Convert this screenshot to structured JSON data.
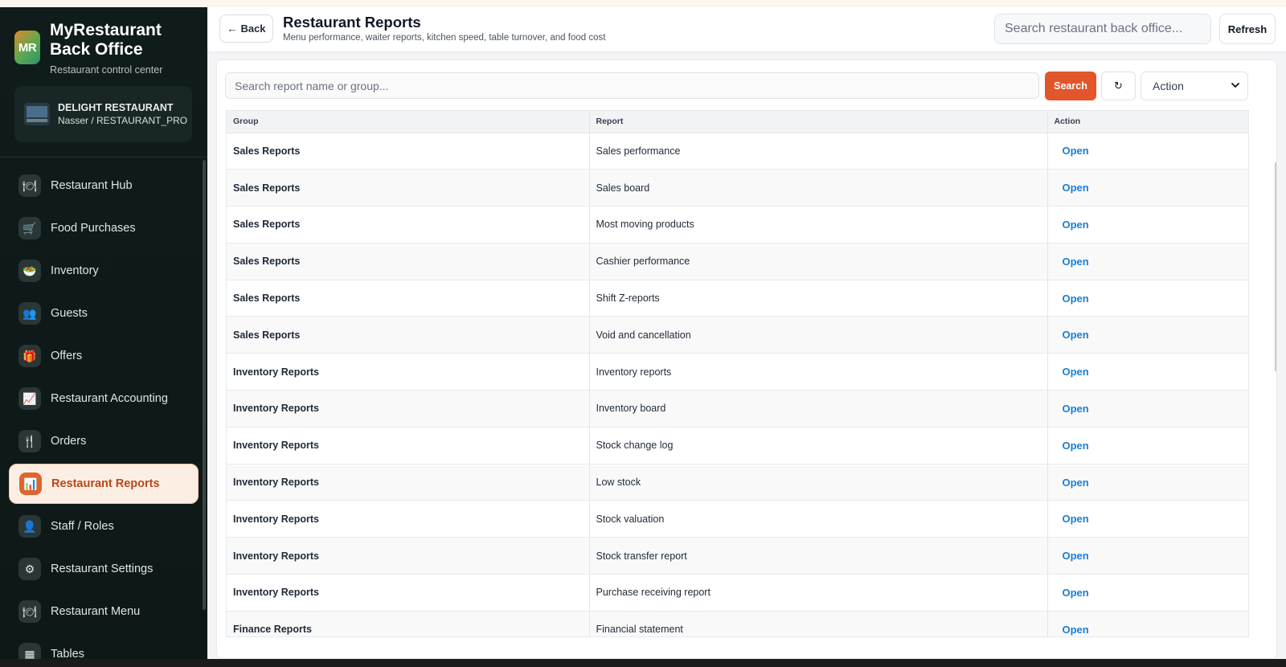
{
  "brand": {
    "logo_text": "MR",
    "title": "MyRestaurant Back Office",
    "subtitle": "Restaurant control center"
  },
  "store": {
    "name": "DELIGHT RESTAURANT",
    "user": "Nasser / RESTAURANT_PRO"
  },
  "sidebar": {
    "items": [
      {
        "label": "Restaurant Hub",
        "icon": "plate-icon",
        "glyph": "🍽"
      },
      {
        "label": "Food Purchases",
        "icon": "cart-icon",
        "glyph": "🛒"
      },
      {
        "label": "Inventory",
        "icon": "bowl-icon",
        "glyph": "🥗"
      },
      {
        "label": "Guests",
        "icon": "people-icon",
        "glyph": "👥"
      },
      {
        "label": "Offers",
        "icon": "gift-icon",
        "glyph": "🎁"
      },
      {
        "label": "Restaurant Accounting",
        "icon": "chart-up-icon",
        "glyph": "📈"
      },
      {
        "label": "Orders",
        "icon": "fork-knife-icon",
        "glyph": "🍴"
      },
      {
        "label": "Restaurant Reports",
        "icon": "bar-chart-icon",
        "glyph": "📊",
        "active": true
      },
      {
        "label": "Staff / Roles",
        "icon": "user-icon",
        "glyph": "👤"
      },
      {
        "label": "Restaurant Settings",
        "icon": "gear-icon",
        "glyph": "⚙"
      },
      {
        "label": "Restaurant Menu",
        "icon": "menu-plate-icon",
        "glyph": "🍽"
      },
      {
        "label": "Tables",
        "icon": "grid-icon",
        "glyph": "▦"
      }
    ]
  },
  "header": {
    "back_label": "Back",
    "title": "Restaurant Reports",
    "subtitle": "Menu performance, waiter reports, kitchen speed, table turnover, and food cost",
    "search_placeholder": "Search restaurant back office...",
    "refresh_label": "Refresh"
  },
  "toolbar": {
    "search_placeholder": "Search report name or group...",
    "search_label": "Search",
    "reset_glyph": "↻",
    "action_value": "Action"
  },
  "table": {
    "columns": [
      "Group",
      "Report",
      "Action"
    ],
    "rows": [
      {
        "group": "Sales Reports",
        "report": "Sales performance",
        "action": "Open"
      },
      {
        "group": "Sales Reports",
        "report": "Sales board",
        "action": "Open"
      },
      {
        "group": "Sales Reports",
        "report": "Most moving products",
        "action": "Open"
      },
      {
        "group": "Sales Reports",
        "report": "Cashier performance",
        "action": "Open"
      },
      {
        "group": "Sales Reports",
        "report": "Shift Z-reports",
        "action": "Open"
      },
      {
        "group": "Sales Reports",
        "report": "Void and cancellation",
        "action": "Open"
      },
      {
        "group": "Inventory Reports",
        "report": "Inventory reports",
        "action": "Open"
      },
      {
        "group": "Inventory Reports",
        "report": "Inventory board",
        "action": "Open"
      },
      {
        "group": "Inventory Reports",
        "report": "Stock change log",
        "action": "Open"
      },
      {
        "group": "Inventory Reports",
        "report": "Low stock",
        "action": "Open"
      },
      {
        "group": "Inventory Reports",
        "report": "Stock valuation",
        "action": "Open"
      },
      {
        "group": "Inventory Reports",
        "report": "Stock transfer report",
        "action": "Open"
      },
      {
        "group": "Inventory Reports",
        "report": "Purchase receiving report",
        "action": "Open"
      },
      {
        "group": "Finance Reports",
        "report": "Financial statement",
        "action": "Open"
      }
    ]
  },
  "colors": {
    "accent": "#e2562b",
    "link": "#1a7fd4",
    "sidebar_bg": "#0f1c1b",
    "active_item_bg": "#fdeee4"
  }
}
